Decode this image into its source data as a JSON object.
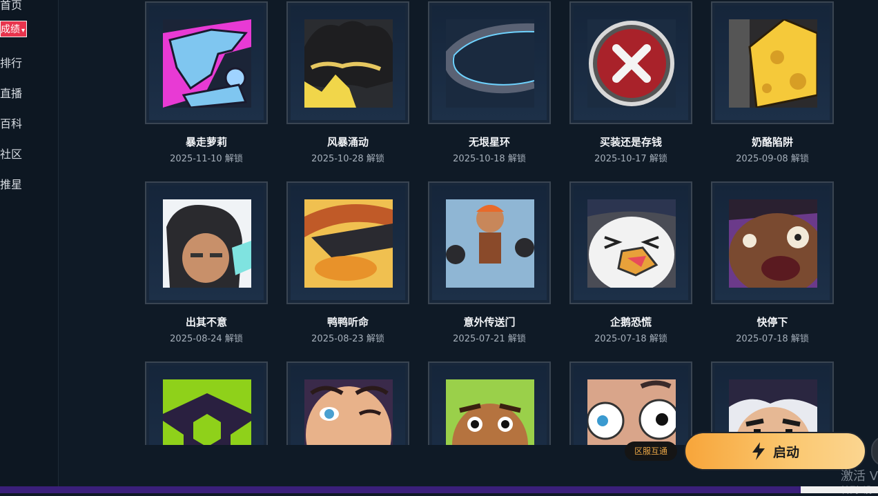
{
  "sidebar": {
    "items": [
      {
        "label": "首页"
      },
      {
        "label": "成绩"
      },
      {
        "label": "排行"
      },
      {
        "label": "直播"
      },
      {
        "label": "百科"
      },
      {
        "label": "社区"
      },
      {
        "label": "推星"
      }
    ],
    "active_index": 1,
    "active_caret": "▾",
    "accent_color": "#e8344d"
  },
  "achievements": [
    {
      "name": "暴走萝莉",
      "date": "2025-11-10 解锁",
      "icon": "shark-hand-icon"
    },
    {
      "name": "风暴涌动",
      "date": "2025-10-28 解锁",
      "icon": "crown-hair-icon"
    },
    {
      "name": "无垠星环",
      "date": "2025-10-18 解锁",
      "icon": "ring-icon"
    },
    {
      "name": "买装还是存钱",
      "date": "2025-10-17 解锁",
      "icon": "x-circle-icon"
    },
    {
      "name": "奶酪陷阱",
      "date": "2025-09-08 解锁",
      "icon": "cheese-icon"
    },
    {
      "name": "出其不意",
      "date": "2025-08-24 解锁",
      "icon": "chibi-agent-icon"
    },
    {
      "name": "鸭鸭听命",
      "date": "2025-08-23 解锁",
      "icon": "duck-icon"
    },
    {
      "name": "意外传送门",
      "date": "2025-07-21 解锁",
      "icon": "agents-group-icon"
    },
    {
      "name": "企鹅恐慌",
      "date": "2025-07-18 解锁",
      "icon": "penguin-icon"
    },
    {
      "name": "快停下",
      "date": "2025-07-18 解锁",
      "icon": "shocked-face-icon"
    },
    {
      "name": "",
      "date": "",
      "icon": "hex-pattern-icon"
    },
    {
      "name": "",
      "date": "",
      "icon": "wink-face-icon"
    },
    {
      "name": "",
      "date": "",
      "icon": "green-hair-face-icon"
    },
    {
      "name": "",
      "date": "",
      "icon": "big-eyes-face-icon"
    },
    {
      "name": "",
      "date": "",
      "icon": "purple-hair-face-icon"
    }
  ],
  "region_badge": "区服互通",
  "launch": {
    "label": "启动",
    "icon": "lightning-icon"
  },
  "watermark": {
    "line1": "激活 V",
    "line2": "转到\"设"
  }
}
